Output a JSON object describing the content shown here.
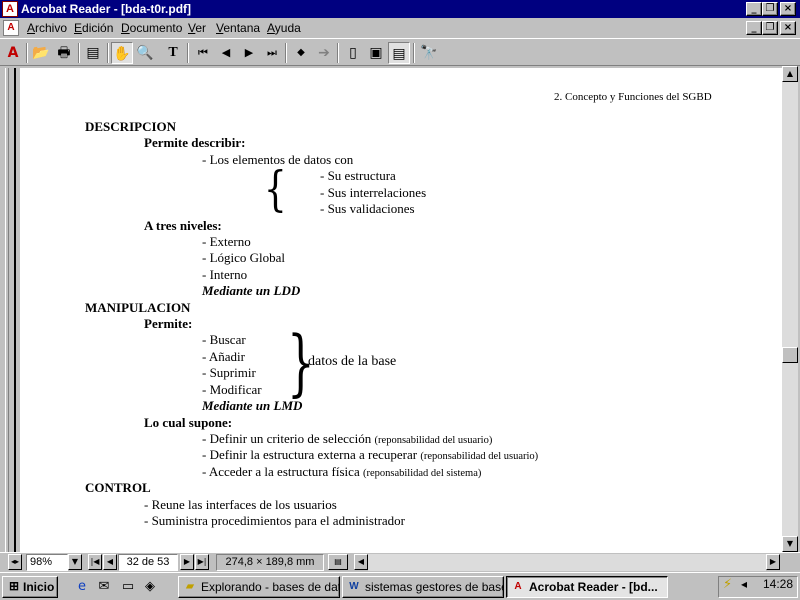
{
  "window": {
    "title": "Acrobat Reader - [bda-t0r.pdf]",
    "app_icon": "acrobat-icon",
    "app_icon_glyph": "A",
    "minimize_glyph": "_",
    "restore_glyph": "❐",
    "close_glyph": "×"
  },
  "menubar": {
    "items": [
      {
        "accel": "A",
        "rest": "rchivo"
      },
      {
        "accel": "E",
        "rest": "dición"
      },
      {
        "accel": "D",
        "rest": "ocumento"
      },
      {
        "accel": "V",
        "rest": "er"
      },
      {
        "accel": "V",
        "rest": "entana"
      },
      {
        "accel": "A",
        "rest": "yuda"
      }
    ]
  },
  "toolbar": {
    "icons": [
      "acrobat-logo-icon",
      "open-folder-icon",
      "print-icon",
      "show-bookmarks-icon",
      "hand-tool-icon",
      "zoom-tool-icon",
      "text-select-icon",
      "first-page-icon",
      "prev-page-icon",
      "next-page-icon",
      "last-page-icon",
      "go-back-icon",
      "go-forward-icon",
      "actual-size-icon",
      "fit-page-icon",
      "fit-width-icon",
      "find-icon"
    ],
    "glyphs": {
      "logo": "A",
      "open": "📂",
      "print": "🖶",
      "bookmarks": "▤",
      "hand": "✋",
      "zoom": "🔍",
      "text": "T",
      "first": "⏮",
      "prev": "◀",
      "next": "▶",
      "last": "⏭",
      "back": "◆",
      "forward": "➔",
      "actual": "▯",
      "fitpage": "▣",
      "fitwidth": "▤",
      "find": "🔭"
    }
  },
  "document": {
    "header": "2. Concepto y Funciones del SGBD",
    "descripcion": {
      "heading": "DESCRIPCION",
      "permite_describir": "Permite describir:",
      "elementos": "- Los elementos de datos con",
      "sub": [
        "- Su estructura",
        "- Sus interrelaciones",
        "- Sus validaciones"
      ],
      "tres_niveles": "A tres niveles:",
      "niveles": [
        "- Externo",
        "- Lógico Global",
        "- Interno"
      ],
      "mediante": "Mediante un LDD"
    },
    "manipulacion": {
      "heading": "MANIPULACION",
      "permite": "Permite:",
      "ops": [
        "- Buscar",
        "- Añadir",
        "- Suprimir",
        "- Modificar"
      ],
      "datos_base": "datos de la base",
      "mediante": "Mediante un LMD",
      "lo_cual": "Lo cual supone:",
      "supone": [
        {
          "main": "- Definir un criterio de selección",
          "note": "(reponsabilidad del usuario)"
        },
        {
          "main": "- Definir la estructura externa a recuperar",
          "note": "(reponsabilidad del usuario)"
        },
        {
          "main": "- Acceder a la estructura física",
          "note": "(reponsabilidad del sistema)"
        }
      ]
    },
    "control": {
      "heading": "CONTROL",
      "items": [
        "- Reune las interfaces de los usuarios",
        "- Suministra procedimientos para el administrador"
      ]
    }
  },
  "statusbar": {
    "zoom": "98%",
    "page": "32 de 53",
    "page_size": "274,8 × 189,8  mm"
  },
  "taskbar": {
    "start": "Inicio",
    "tasks": [
      {
        "label": "Explorando - bases de datos",
        "icon": "explorer-folder-icon",
        "active": false
      },
      {
        "label": "sistemas gestores de base...",
        "icon": "word-document-icon",
        "active": false
      },
      {
        "label": "Acrobat Reader - [bd...",
        "icon": "acrobat-icon",
        "active": true
      }
    ],
    "clock": "14:28"
  },
  "colors": {
    "titlebar": "#000080",
    "face": "#c0c0c0",
    "acrobat_red": "#c00000"
  }
}
